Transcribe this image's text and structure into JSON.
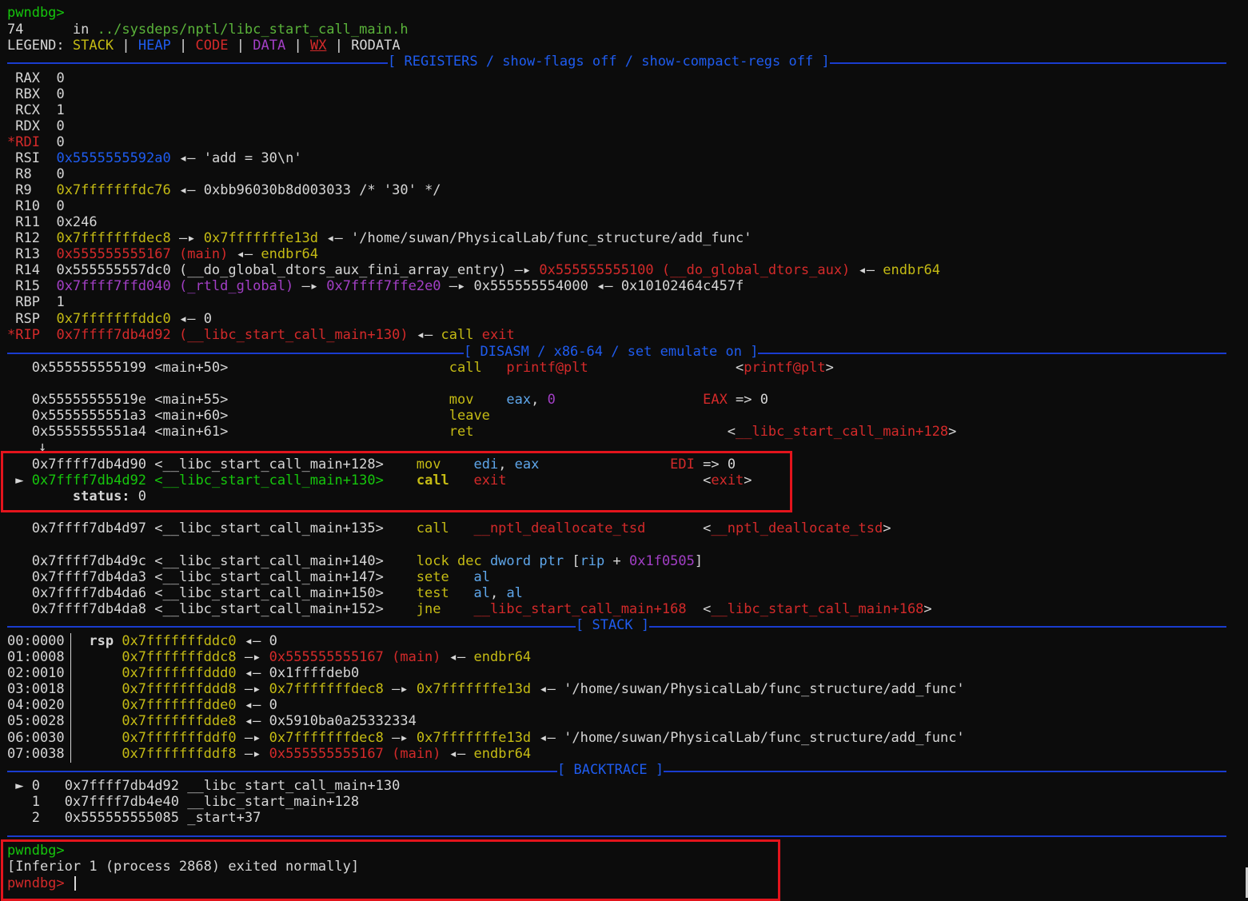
{
  "top": {
    "prompt": "pwndbg>",
    "line_num": "74",
    "in_kw": "in",
    "file": "../sysdeps/nptl/libc_start_call_main.h",
    "legend_label": "LEGEND:",
    "legend": [
      "STACK",
      "HEAP",
      "CODE",
      "DATA",
      "WX",
      "RODATA"
    ],
    "pipe": "|"
  },
  "sections": {
    "registers": "[ REGISTERS / show-flags off / show-compact-regs off ]",
    "disasm": "[ DISASM / x86-64 / set emulate on ]",
    "stack": "[ STACK ]",
    "backtrace": "[ BACKTRACE ]"
  },
  "sym": {
    "larrow": "◂—",
    "rarrow": "—▸",
    "star": "*",
    "marker": "►",
    "down": "↓",
    "lt": "<",
    "gt": ">",
    "comma": ", ",
    "result_arrow": " => ",
    "zero": "0",
    "endbr": "endbr64"
  },
  "registers": [
    {
      "name": "RAX",
      "val": "0"
    },
    {
      "name": "RBX",
      "val": "0"
    },
    {
      "name": "RCX",
      "val": "1"
    },
    {
      "name": "RDX",
      "val": "0"
    },
    {
      "name": "RDI",
      "val": "0"
    },
    {
      "name": "RSI",
      "val": "0x5555555592a0",
      "str": "'add = 30\\n'"
    },
    {
      "name": "R8",
      "val": "0"
    },
    {
      "name": "R9",
      "val": "0x7fffffffdc76",
      "deref": "0xbb96030b8d003033 /* '30' */"
    },
    {
      "name": "R10",
      "val": "0"
    },
    {
      "name": "R11",
      "val": "0x246"
    },
    {
      "name": "R12",
      "val": "0x7fffffffdec8",
      "v2": "0x7fffffffe13d",
      "str": "'/home/suwan/PhysicalLab/func_structure/add_func'"
    },
    {
      "name": "R13",
      "val": "0x555555555167 (main)",
      "ins": "endbr64"
    },
    {
      "name": "R14",
      "val": "0x555555557dc0 (__do_global_dtors_aux_fini_array_entry)",
      "v2": "0x555555555100 (__do_global_dtors_aux)",
      "ins": "endbr64"
    },
    {
      "name": "R15",
      "val": "0x7ffff7ffd040 (_rtld_global)",
      "v2": "0x7ffff7ffe2e0",
      "v3": "0x555555554000",
      "v4": "0x10102464c457f"
    },
    {
      "name": "RBP",
      "val": "1"
    },
    {
      "name": "RSP",
      "val": "0x7fffffffddc0",
      "v2": "0"
    },
    {
      "name": "RIP",
      "val": "0x7ffff7db4d92 (__libc_start_call_main+130)",
      "ins1": "call",
      "ins2": "exit"
    }
  ],
  "disasm": [
    {
      "addr": "0x555555555199",
      "sym": "<main+50>",
      "op": "call",
      "arg": "printf@plt",
      "tgt": "printf@plt"
    },
    {
      "addr": "0x55555555519e",
      "sym": "<main+55>",
      "op": "mov",
      "arg1": "eax",
      "arg2": "0",
      "res_reg": "EAX",
      "res_val": "0"
    },
    {
      "addr": "0x5555555551a3",
      "sym": "<main+60>",
      "op": "leave"
    },
    {
      "addr": "0x5555555551a4",
      "sym": "<main+61>",
      "op": "ret",
      "tgt": "__libc_start_call_main+128"
    },
    {
      "addr": "0x7ffff7db4d90",
      "sym": "<__libc_start_call_main+128>",
      "op": "mov",
      "arg1": "edi",
      "arg2": "eax",
      "res_reg": "EDI",
      "res_val": "0"
    },
    {
      "addr": "0x7ffff7db4d92",
      "sym": "<__libc_start_call_main+130>",
      "op": "call",
      "arg": "exit",
      "tgt": "exit"
    },
    {
      "status_label": "status:",
      "status_val": "0"
    },
    {
      "addr": "0x7ffff7db4d97",
      "sym": "<__libc_start_call_main+135>",
      "op": "call",
      "arg": "__nptl_deallocate_tsd",
      "tgt": "__nptl_deallocate_tsd"
    },
    {
      "addr": "0x7ffff7db4d9c",
      "sym": "<__libc_start_call_main+140>",
      "op": "lock dec",
      "kw": "dword ptr",
      "lb": "[",
      "reg": "rip",
      "plus": " + ",
      "off": "0x1f0505",
      "rb": "]"
    },
    {
      "addr": "0x7ffff7db4da3",
      "sym": "<__libc_start_call_main+147>",
      "op": "sete",
      "arg": "al"
    },
    {
      "addr": "0x7ffff7db4da6",
      "sym": "<__libc_start_call_main+150>",
      "op": "test",
      "arg1": "al",
      "arg2": "al"
    },
    {
      "addr": "0x7ffff7db4da8",
      "sym": "<__libc_start_call_main+152>",
      "op": "jne",
      "arg": "__libc_start_call_main+168",
      "tgt": "__libc_start_call_main+168"
    }
  ],
  "stack": {
    "rsp": "rsp",
    "rows": [
      {
        "idx": "00:0000",
        "addr": "0x7fffffffddc0",
        "v1": "0"
      },
      {
        "idx": "01:0008",
        "addr": "0x7fffffffddc8",
        "v1": "0x555555555167 (main)",
        "v2": "endbr64"
      },
      {
        "idx": "02:0010",
        "addr": "0x7fffffffddd0",
        "v1": "0x1ffffdeb0"
      },
      {
        "idx": "03:0018",
        "addr": "0x7fffffffddd8",
        "v1": "0x7fffffffdec8",
        "v2": "0x7fffffffe13d",
        "v3": "'/home/suwan/PhysicalLab/func_structure/add_func'"
      },
      {
        "idx": "04:0020",
        "addr": "0x7fffffffdde0",
        "v1": "0"
      },
      {
        "idx": "05:0028",
        "addr": "0x7fffffffdde8",
        "v1": "0x5910ba0a25332334"
      },
      {
        "idx": "06:0030",
        "addr": "0x7fffffffddf0",
        "v1": "0x7fffffffdec8",
        "v2": "0x7fffffffe13d",
        "v3": "'/home/suwan/PhysicalLab/func_structure/add_func'"
      },
      {
        "idx": "07:0038",
        "addr": "0x7fffffffddf8",
        "v1": "0x555555555167 (main)",
        "v2": "endbr64"
      }
    ]
  },
  "backtrace": [
    {
      "n": "0",
      "addr": "0x7ffff7db4d92",
      "sym": "__libc_start_call_main+130"
    },
    {
      "n": "1",
      "addr": "0x7ffff7db4e40",
      "sym": "__libc_start_main+128"
    },
    {
      "n": "2",
      "addr": "0x555555555085",
      "sym": "_start+37"
    }
  ],
  "footer": {
    "prompt": "pwndbg>",
    "exit_msg": "[Inferior 1 (process 2868) exited normally]",
    "prompt2": "pwndbg>"
  }
}
